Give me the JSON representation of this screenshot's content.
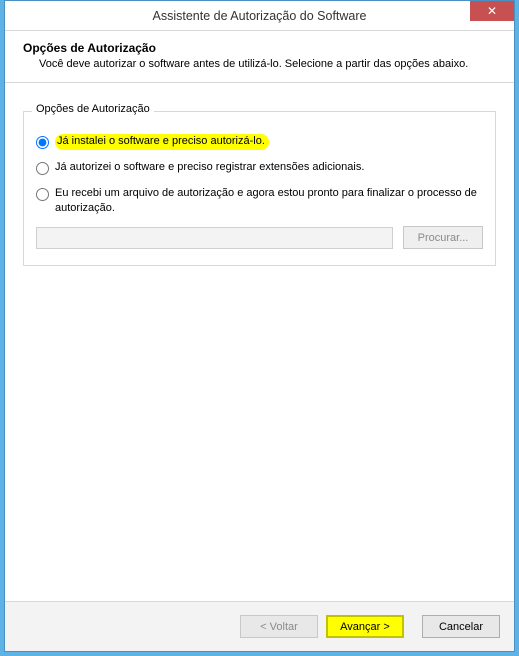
{
  "titlebar": {
    "title": "Assistente de Autorização do Software",
    "close_glyph": "✕"
  },
  "header": {
    "title": "Opções de Autorização",
    "description": "Você deve autorizar o software antes de utilizá-lo. Selecione a partir das opções abaixo."
  },
  "group": {
    "legend": "Opções de Autorização",
    "options": [
      {
        "label": "Já instalei o software e preciso autorizá-lo.",
        "checked": true,
        "highlighted": true
      },
      {
        "label": "Já autorizei o software e preciso registrar extensões adicionais.",
        "checked": false,
        "highlighted": false
      },
      {
        "label": "Eu recebi um arquivo de autorização e agora estou pronto para finalizar o processo de autorização.",
        "checked": false,
        "highlighted": false
      }
    ],
    "browse_label": "Procurar...",
    "file_value": ""
  },
  "footer": {
    "back_label": "< Voltar",
    "next_label": "Avançar >",
    "cancel_label": "Cancelar"
  }
}
